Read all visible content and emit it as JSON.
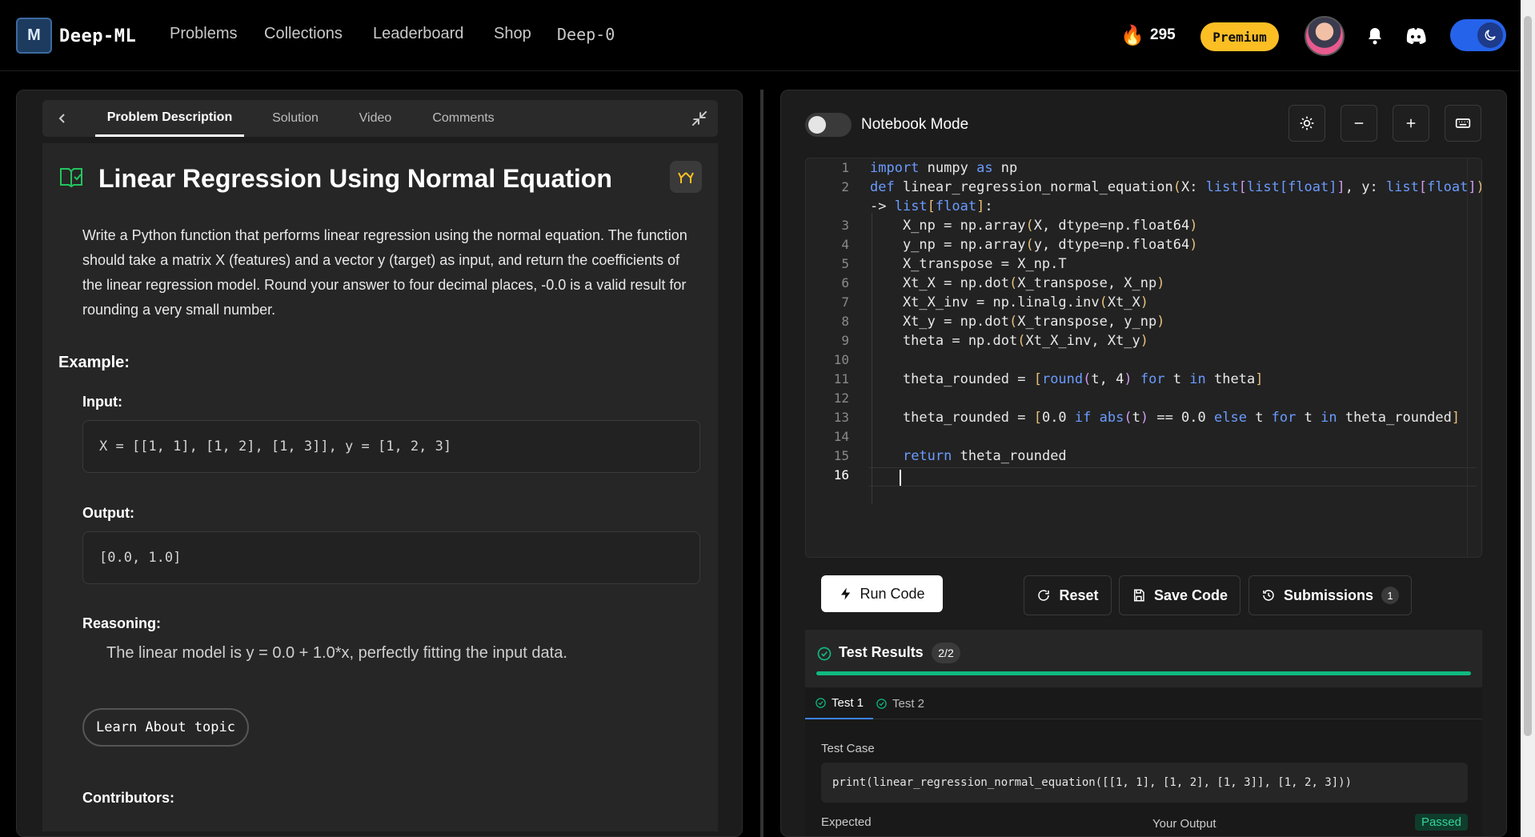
{
  "nav": {
    "brand": "Deep-ML",
    "links": [
      "Problems",
      "Collections",
      "Leaderboard",
      "Shop",
      "Deep-0"
    ],
    "streak": "295",
    "premium": "Premium"
  },
  "left": {
    "tabs": [
      "Problem Description",
      "Solution",
      "Video",
      "Comments"
    ],
    "title": "Linear Regression Using Normal Equation",
    "description": "Write a Python function that performs linear regression using the normal equation. The function should take a matrix X (features) and a vector y (target) as input, and return the coefficients of the linear regression model. Round your answer to four decimal places, -0.0 is a valid result for rounding a very small number.",
    "example_heading": "Example:",
    "input_label": "Input:",
    "input_value": "X = [[1, 1], [1, 2], [1, 3]], y = [1, 2, 3]",
    "output_label": "Output:",
    "output_value": "[0.0, 1.0]",
    "reasoning_label": "Reasoning:",
    "reasoning_text": "The linear model is y = 0.0 + 1.0*x, perfectly fitting the input data.",
    "learn_button": "Learn About topic",
    "contributors_label": "Contributors:"
  },
  "right": {
    "notebook_label": "Notebook Mode",
    "line_numbers": [
      "1",
      "2",
      "",
      "3",
      "4",
      "5",
      "6",
      "7",
      "8",
      "9",
      "10",
      "11",
      "12",
      "13",
      "14",
      "15",
      "16"
    ],
    "run_label": "Run Code",
    "reset_label": "Reset",
    "save_label": "Save Code",
    "submissions_label": "Submissions",
    "submissions_count": "1",
    "results_title": "Test Results",
    "results_badge": "2/2",
    "results_progress": 1.0,
    "test_tabs": [
      "Test 1",
      "Test 2"
    ],
    "test_case_label": "Test Case",
    "test_case_code": "print(linear_regression_normal_equation([[1, 1], [1, 2], [1, 3]], [1, 2, 3]))",
    "expected_label": "Expected",
    "your_output_label": "Your Output",
    "passed_label": "Passed"
  },
  "colors": {
    "accent_green": "#10b981",
    "premium_yellow": "#fbbf24",
    "toggle_blue": "#2563eb",
    "keyword_blue": "#6b9bff",
    "bracket_gold": "#e5c07b"
  }
}
